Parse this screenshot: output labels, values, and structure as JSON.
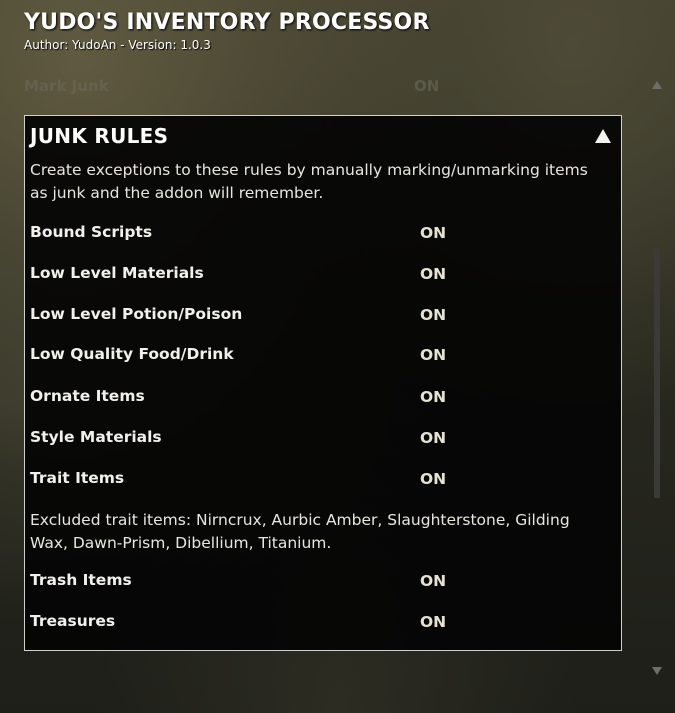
{
  "header": {
    "title": "YUDO'S INVENTORY PROCESSOR",
    "subtitle": "Author: YudoAn - Version: 1.0.3"
  },
  "previous_row": {
    "label": "Mark Junk",
    "value": "ON"
  },
  "section": {
    "title": "JUNK RULES",
    "description": "Create exceptions to these rules by manually marking/unmarking items as junk and the addon will remember.",
    "excluded_note": "Excluded trait items: Nirncrux, Aurbic Amber, Slaughterstone, Gilding Wax, Dawn-Prism, Dibellium, Titanium.",
    "rules": [
      {
        "label": "Bound Scripts",
        "value": "ON"
      },
      {
        "label": "Low Level Materials",
        "value": "ON"
      },
      {
        "label": "Low Level Potion/Poison",
        "value": "ON"
      },
      {
        "label": "Low Quality Food/Drink",
        "value": "ON"
      },
      {
        "label": "Ornate Items",
        "value": "ON"
      },
      {
        "label": "Style Materials",
        "value": "ON"
      },
      {
        "label": "Trait Items",
        "value": "ON"
      },
      {
        "label": "Trash Items",
        "value": "ON"
      },
      {
        "label": "Treasures",
        "value": "ON"
      }
    ]
  },
  "icons": {
    "collapse": "triangle-up-icon",
    "scroll_up": "scroll-up-arrow-icon",
    "scroll_down": "scroll-down-arrow-icon"
  },
  "colors": {
    "panel_bg": "#040404",
    "panel_border": "#cfcfcf",
    "text": "#e8e6df",
    "value_text": "#e6e2d2"
  }
}
